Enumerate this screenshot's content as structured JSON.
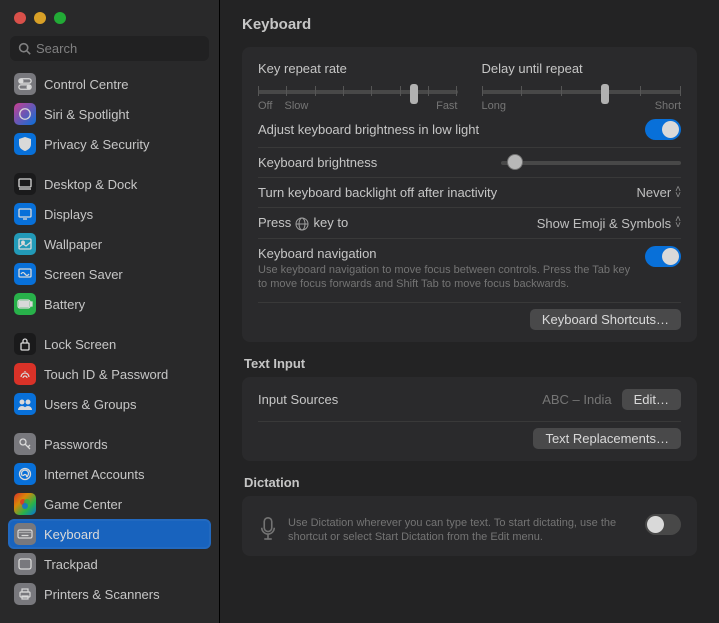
{
  "window": {
    "search_placeholder": "Search",
    "page_title": "Keyboard"
  },
  "sidebar": {
    "groups": [
      [
        {
          "label": "Control Centre",
          "icon": "control-centre",
          "bg": "#8e8e93"
        },
        {
          "label": "Siri & Spotlight",
          "icon": "siri",
          "bg": "linear-gradient(135deg,#ec4aab,#0a84ff)"
        },
        {
          "label": "Privacy & Security",
          "icon": "privacy",
          "bg": "#0a84ff"
        }
      ],
      [
        {
          "label": "Desktop & Dock",
          "icon": "desktop-dock",
          "bg": "#1f1f20"
        },
        {
          "label": "Displays",
          "icon": "displays",
          "bg": "#0a84ff"
        },
        {
          "label": "Wallpaper",
          "icon": "wallpaper",
          "bg": "#28b6d9"
        },
        {
          "label": "Screen Saver",
          "icon": "screen-saver",
          "bg": "#0a84ff"
        },
        {
          "label": "Battery",
          "icon": "battery",
          "bg": "#30d158"
        }
      ],
      [
        {
          "label": "Lock Screen",
          "icon": "lock-screen",
          "bg": "#1f1f20"
        },
        {
          "label": "Touch ID & Password",
          "icon": "touch-id",
          "bg": "#ff3b30"
        },
        {
          "label": "Users & Groups",
          "icon": "users-groups",
          "bg": "#0a84ff"
        }
      ],
      [
        {
          "label": "Passwords",
          "icon": "passwords",
          "bg": "#8e8e93"
        },
        {
          "label": "Internet Accounts",
          "icon": "internet-accounts",
          "bg": "#0a84ff"
        },
        {
          "label": "Game Center",
          "icon": "game-center",
          "bg": "linear-gradient(135deg,#ff3b30,#ff9f0a,#30d158,#0a84ff)"
        },
        {
          "label": "Keyboard",
          "icon": "keyboard",
          "bg": "#8e8e93",
          "selected": true
        },
        {
          "label": "Trackpad",
          "icon": "trackpad",
          "bg": "#8e8e93"
        },
        {
          "label": "Printers & Scanners",
          "icon": "printers",
          "bg": "#8e8e93"
        }
      ]
    ]
  },
  "keyboard": {
    "repeat_rate_label": "Key repeat rate",
    "repeat_rate_left": "Off",
    "repeat_rate_left2": "Slow",
    "repeat_rate_right": "Fast",
    "repeat_rate_value": 0.76,
    "delay_label": "Delay until repeat",
    "delay_left": "Long",
    "delay_right": "Short",
    "delay_value": 0.6,
    "auto_brightness_label": "Adjust keyboard brightness in low light",
    "auto_brightness_on": true,
    "brightness_label": "Keyboard brightness",
    "brightness_value": 0.06,
    "backlight_off_label": "Turn keyboard backlight off after inactivity",
    "backlight_off_value": "Never",
    "globe_label_pre": "Press",
    "globe_label_post": "key to",
    "globe_value": "Show Emoji & Symbols",
    "nav_label": "Keyboard navigation",
    "nav_sub": "Use keyboard navigation to move focus between controls. Press the Tab key to move focus forwards and Shift Tab to move focus backwards.",
    "nav_on": true,
    "shortcuts_button": "Keyboard Shortcuts…"
  },
  "text_input": {
    "section": "Text Input",
    "sources_label": "Input Sources",
    "sources_value": "ABC – India",
    "edit_button": "Edit…",
    "replacements_button": "Text Replacements…"
  },
  "dictation": {
    "section": "Dictation",
    "sub": "Use Dictation wherever you can type text. To start dictating, use the shortcut or select Start Dictation from the Edit menu.",
    "on": false
  }
}
